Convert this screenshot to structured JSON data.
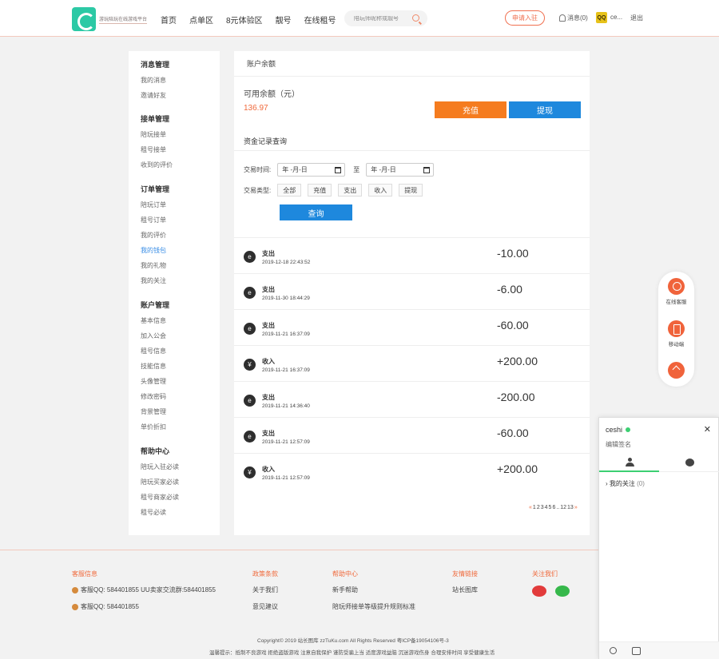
{
  "header": {
    "logo_text": "游玩陪玩在线游戏平台",
    "nav": [
      "首页",
      "点单区",
      "8元体验区",
      "靓号",
      "在线租号"
    ],
    "search_placeholder": "陪玩师昵称或靓号",
    "apply_label": "申请入驻",
    "message_label": "消息(0)",
    "avatar_text": "QQ",
    "user_name": "ce...",
    "logout_label": "退出"
  },
  "sidebar": {
    "groups": [
      {
        "title": "消息管理",
        "items": [
          "我的消息",
          "邀请好友"
        ]
      },
      {
        "title": "接单管理",
        "items": [
          "陪玩接单",
          "租号接单",
          "收到的评价"
        ]
      },
      {
        "title": "订单管理",
        "items": [
          "陪玩订单",
          "租号订单",
          "我的评价",
          "我的钱包",
          "我的礼物",
          "我的关注"
        ]
      },
      {
        "title": "账户管理",
        "items": [
          "基本信息",
          "加入公会",
          "租号信息",
          "技能信息",
          "头像管理",
          "修改密码",
          "背景管理",
          "单价折扣"
        ]
      },
      {
        "title": "帮助中心",
        "items": [
          "陪玩入驻必读",
          "陪玩买家必读",
          "租号商家必读",
          "租号必读"
        ]
      }
    ],
    "active_item": "我的钱包"
  },
  "main": {
    "title": "账户余额",
    "balance_label": "可用余额（元）",
    "balance_value": "136.97",
    "recharge_label": "充值",
    "withdraw_label": "提现",
    "record_title": "资金记录查询",
    "time_label": "交易时间:",
    "date_placeholder": "年 -月-日",
    "to_label": "至",
    "type_label": "交易类型:",
    "types": [
      "全部",
      "充值",
      "支出",
      "收入",
      "提现"
    ],
    "query_label": "查询",
    "records": [
      {
        "icon": "e",
        "type": "支出",
        "time": "2019-12-18 22:43:52",
        "amount": "-10.00"
      },
      {
        "icon": "e",
        "type": "支出",
        "time": "2019-11-30 18:44:29",
        "amount": "-6.00"
      },
      {
        "icon": "e",
        "type": "支出",
        "time": "2019-11-21 16:37:09",
        "amount": "-60.00"
      },
      {
        "icon": "¥",
        "type": "收入",
        "time": "2019-11-21 16:37:09",
        "amount": "+200.00"
      },
      {
        "icon": "e",
        "type": "支出",
        "time": "2019-11-21 14:36:40",
        "amount": "-200.00"
      },
      {
        "icon": "e",
        "type": "支出",
        "time": "2019-11-21 12:57:09",
        "amount": "-60.00"
      },
      {
        "icon": "¥",
        "type": "收入",
        "time": "2019-11-21 12:57:09",
        "amount": "+200.00"
      }
    ],
    "pager": {
      "prev": "«",
      "pages": [
        "1",
        "2",
        "3",
        "4",
        "5",
        "6",
        "..",
        "12",
        "13"
      ],
      "next": "»"
    }
  },
  "float_bar": {
    "service": "在线客服",
    "mobile": "移动端"
  },
  "chat": {
    "user": "ceshi",
    "sign": "编辑签名",
    "follow_label": "我的关注",
    "follow_count": "(0)"
  },
  "footer": {
    "col1_head": "客服信息",
    "col1_items": [
      "客服QQ: 584401855 UU卖家交流群:584401855",
      "客服QQ: 584401855"
    ],
    "col2_head": "政策条款",
    "col2_items": [
      "关于我们",
      "意见建议"
    ],
    "col3_head": "帮助中心",
    "col3_items": [
      "新手帮助",
      "陪玩师接单等级提升规则标准"
    ],
    "col4_head": "友情链接",
    "col4_items": [
      "站长图库"
    ],
    "col5_head": "关注我们",
    "copyright": "Copyright© 2019 站长图库 zzTuKu.com All Rights Reserved 粤ICP备19054106号-3",
    "tips": "温馨提示：抵制不良游戏 拒绝盗版游戏 注意自我保护 谨防受骗上当 适度游戏益脑 沉迷游戏伤身 合理安排时间 享受健康生活"
  }
}
